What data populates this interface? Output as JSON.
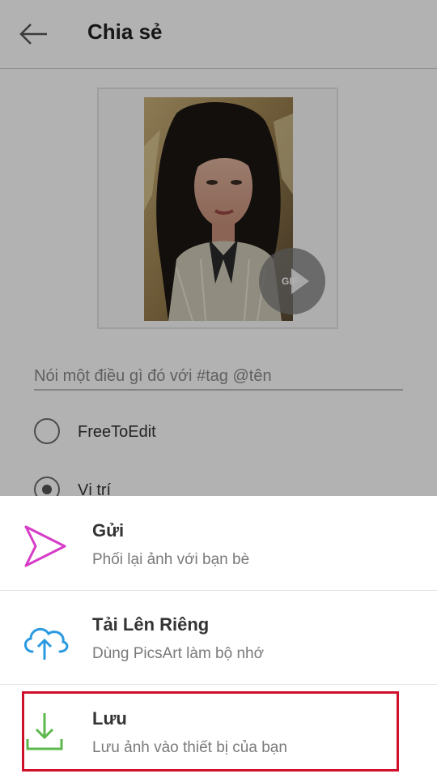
{
  "header": {
    "title": "Chia sẻ"
  },
  "preview": {
    "badge": "GIF"
  },
  "caption": {
    "placeholder": "Nói một điều gì đó với #tag @tên"
  },
  "options": [
    {
      "label": "FreeToEdit",
      "selected": false
    },
    {
      "label": "Vị trí",
      "selected": true
    }
  ],
  "share_sheet": {
    "items": [
      {
        "title": "Gửi",
        "subtitle": "Phối lại ảnh với bạn bè",
        "icon": "send-icon",
        "color": "#d63cc8"
      },
      {
        "title": "Tải Lên Riêng",
        "subtitle": "Dùng PicsArt làm bộ nhớ",
        "icon": "cloud-upload-icon",
        "color": "#2b9ae0"
      },
      {
        "title": "Lưu",
        "subtitle": "Lưu ảnh vào thiết bị của bạn",
        "icon": "download-icon",
        "color": "#5cb84c"
      }
    ]
  },
  "colors": {
    "highlight": "#d0102a"
  }
}
